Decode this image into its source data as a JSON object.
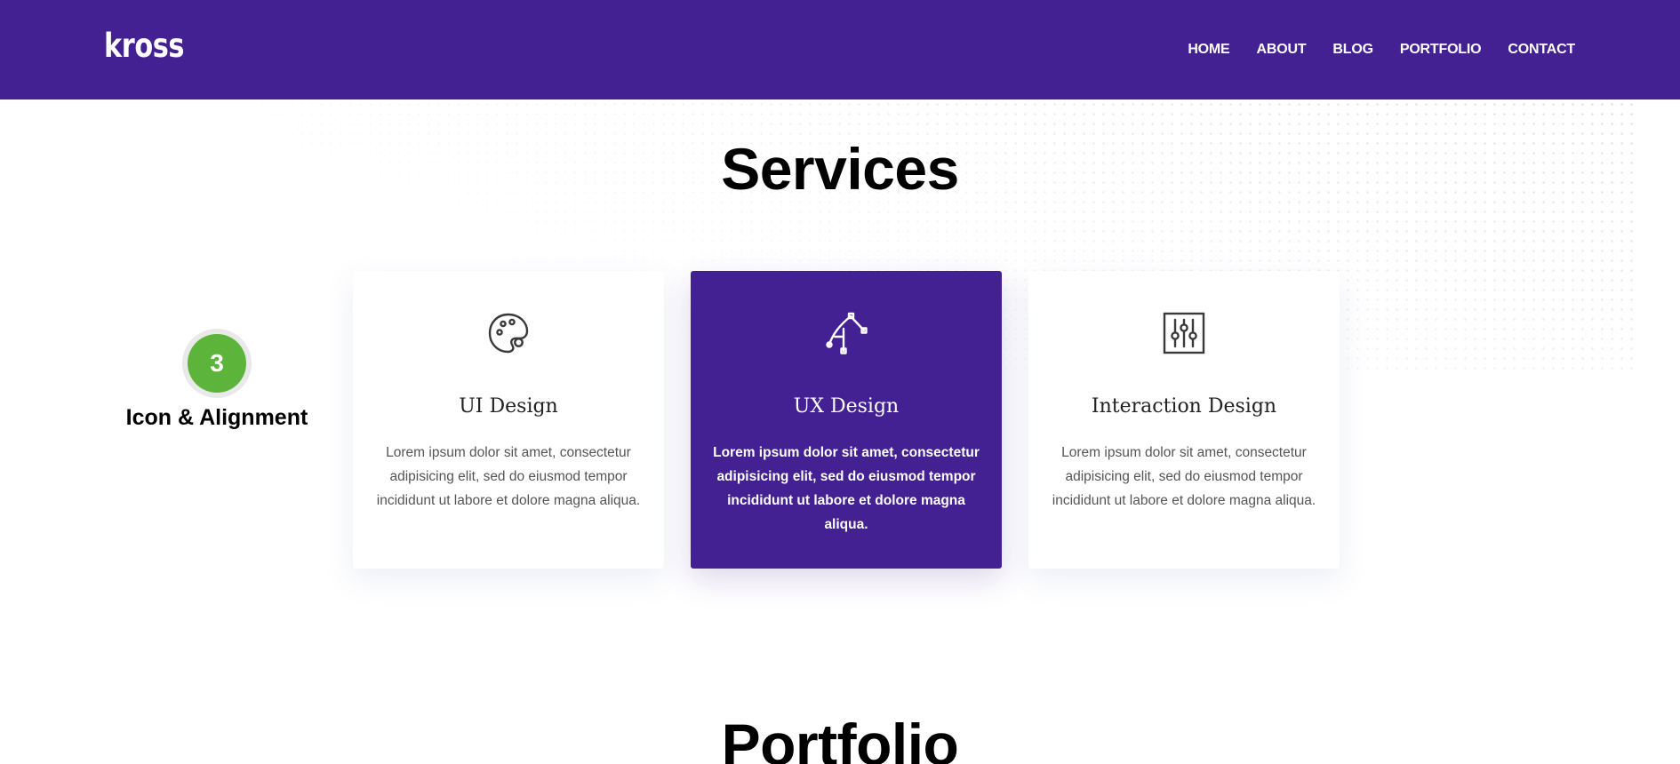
{
  "header": {
    "logo": "kross",
    "nav": [
      "HOME",
      "ABOUT",
      "BLOG",
      "PORTFOLIO",
      "CONTACT"
    ],
    "background_color": "#432192"
  },
  "services": {
    "title": "Services",
    "step": {
      "number": "3",
      "label": "Icon & Alignment",
      "badge_color": "#5cb53a"
    },
    "cards": [
      {
        "icon": "palette-icon",
        "title": "UI Design",
        "description": "Lorem ipsum dolor sit amet, consectetur adipisicing elit, sed do eiusmod tempor incididunt ut labore et dolore magna aliqua."
      },
      {
        "icon": "vector-pen-icon",
        "title": "UX Design",
        "description": "Lorem ipsum dolor sit amet, consectetur adipisicing elit, sed do eiusmod tempor incididunt ut labore et dolore magna aliqua.",
        "highlighted": true
      },
      {
        "icon": "sliders-icon",
        "title": "Interaction Design",
        "description": "Lorem ipsum dolor sit amet, consectetur adipisicing elit, sed do eiusmod tempor incididunt ut labore et dolore magna aliqua."
      }
    ]
  },
  "portfolio": {
    "title": "Portfolio"
  }
}
